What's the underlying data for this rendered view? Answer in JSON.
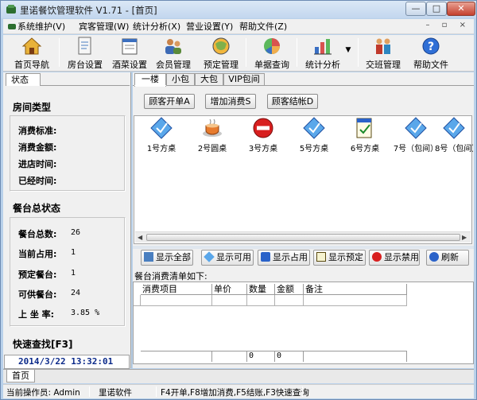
{
  "window": {
    "title": "里诺餐饮管理软件 V1.71 - [首页]",
    "min": "—",
    "max": "□",
    "close": "✕"
  },
  "menu": [
    {
      "label": "系统维护(V)"
    },
    {
      "label": "宾客管理(W)"
    },
    {
      "label": "统计分析(X)"
    },
    {
      "label": "营业设置(Y)"
    },
    {
      "label": "帮助文件(Z)"
    }
  ],
  "mdi_controls": "– ▫ ×",
  "toolbar": {
    "home": "首页导航",
    "room": "房台设置",
    "menu_set": "酒菜设置",
    "member": "会员管理",
    "reserve": "预定管理",
    "bill": "单据查询",
    "stats": "统计分析",
    "shift": "交班管理",
    "help": "帮助文件",
    "dropdown": "▼"
  },
  "left": {
    "tab": "状态",
    "room_type_title": "房间类型",
    "room_rows": [
      {
        "label": "消费标准:",
        "value": ""
      },
      {
        "label": "消费金额:",
        "value": ""
      },
      {
        "label": "进店时间:",
        "value": ""
      },
      {
        "label": "已经时间:",
        "value": ""
      }
    ],
    "overall_title": "餐台总状态",
    "overall_rows": [
      {
        "label": "餐台总数:",
        "value": "26"
      },
      {
        "label": "当前占用:",
        "value": "1"
      },
      {
        "label": "预定餐台:",
        "value": "1"
      },
      {
        "label": "可供餐台:",
        "value": "24"
      },
      {
        "label": "上 坐 率:",
        "value": "3.85 %"
      }
    ],
    "quick_title": "快速查找[F3]",
    "datetime": "2014/3/22 13:32:01"
  },
  "floors": [
    "一楼",
    "小包",
    "大包",
    "VIP包间"
  ],
  "actions": {
    "open": "顾客开单A",
    "add": "增加消费S",
    "checkout": "顾客结帐D"
  },
  "tables": [
    {
      "name": "1号方桌",
      "status": "free"
    },
    {
      "name": "2号圆桌",
      "status": "occupied"
    },
    {
      "name": "3号方桌",
      "status": "disabled"
    },
    {
      "name": "5号方桌",
      "status": "free"
    },
    {
      "name": "6号方桌",
      "status": "reserved"
    },
    {
      "name": "7号（包间）",
      "status": "free"
    },
    {
      "name": "8号（包间）",
      "status": "free"
    }
  ],
  "filters": {
    "all": "显示全部",
    "available": "显示可用",
    "occupied": "显示占用",
    "reserved": "显示预定",
    "disabled": "显示禁用",
    "refresh": "刷新"
  },
  "list": {
    "title": "餐台消费清单如下:",
    "columns": [
      "消费项目",
      "单价",
      "数量",
      "金额",
      "备注"
    ],
    "footer": {
      "qty": "0",
      "amount": "0"
    }
  },
  "page_tab": "首页",
  "status": {
    "operator": "当前操作员: Admin",
    "company": "里诺软件",
    "hint": "F4开单,F8增加消费,F5结账,F3快速查询"
  },
  "colors": {
    "accent": "#2a62c9",
    "disabled": "#d81f1f"
  }
}
